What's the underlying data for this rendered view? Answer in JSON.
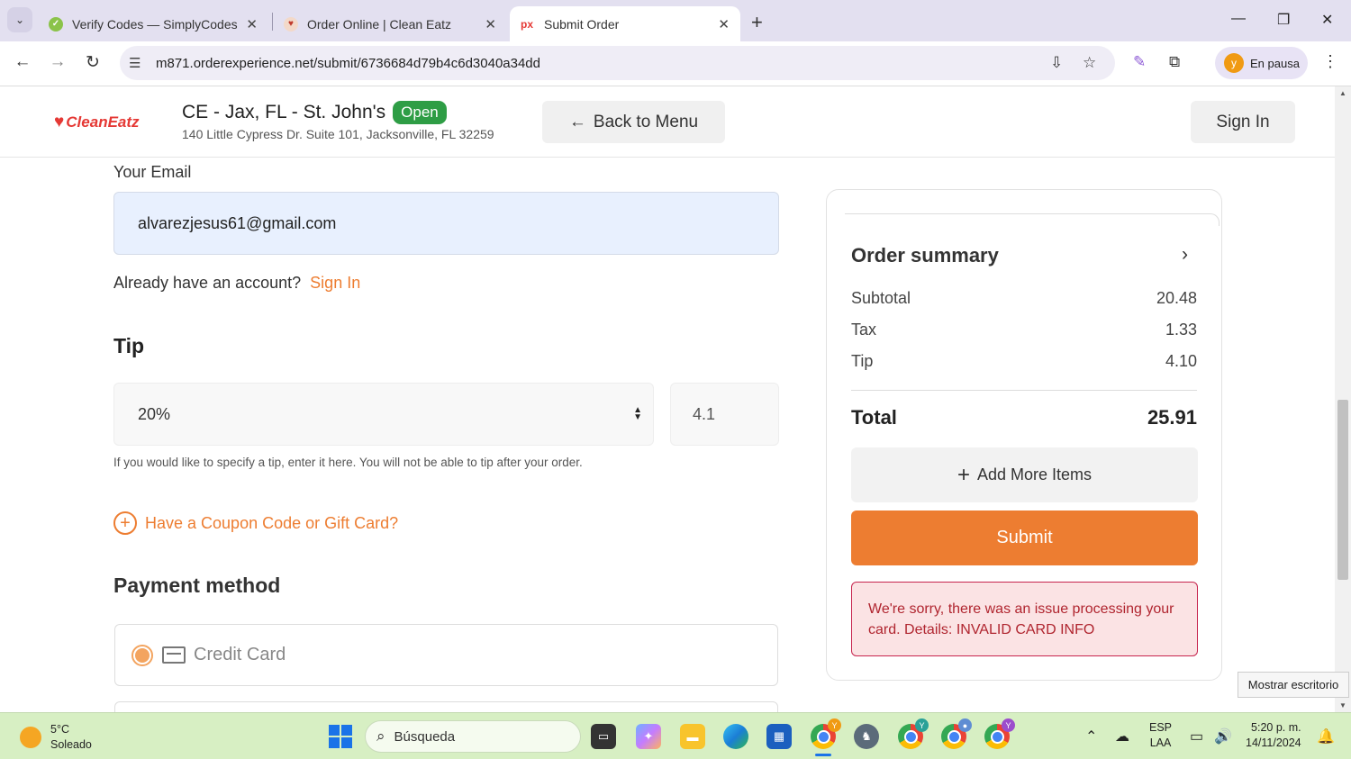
{
  "browser": {
    "tabs": [
      {
        "title": "Verify Codes — SimplyCodes",
        "favicon": "check-icon"
      },
      {
        "title": "Order Online | Clean Eatz",
        "favicon": "clean-eatz-icon"
      },
      {
        "title": "Submit Order",
        "favicon": "px-icon",
        "favicon_text": "px"
      }
    ],
    "url": "m871.orderexperience.net/submit/6736684d79b4c6d3040a34dd",
    "profile_label": "En pausa",
    "profile_initial": "y"
  },
  "header": {
    "logo_text": "CleanEatz",
    "store_name": "CE - Jax, FL - St. John's",
    "status_badge": "Open",
    "address": "140 Little Cypress Dr. Suite 101, Jacksonville, FL 32259",
    "back_label": "Back to Menu",
    "signin_label": "Sign In"
  },
  "form": {
    "email_label": "Your Email",
    "email_value": "alvarezjesus61@gmail.com",
    "account_prompt": "Already have an account?",
    "account_link": "Sign In",
    "tip_title": "Tip",
    "tip_select_value": "20%",
    "tip_amount_value": "4.1",
    "tip_help": "If you would like to specify a tip, enter it here. You will not be able to tip after your order.",
    "coupon_label": "Have a Coupon Code or Gift Card?",
    "payment_title": "Payment method",
    "payment_option": "Credit Card"
  },
  "summary": {
    "title": "Order summary",
    "rows": [
      {
        "label": "Subtotal",
        "value": "20.48"
      },
      {
        "label": "Tax",
        "value": "1.33"
      },
      {
        "label": "Tip",
        "value": "4.10"
      }
    ],
    "total_label": "Total",
    "total_value": "25.91",
    "add_items_label": "Add More Items",
    "submit_label": "Submit",
    "error_text": "We're sorry, there was an issue processing your card. Details: INVALID CARD INFO"
  },
  "tooltip": "Mostrar escritorio",
  "taskbar": {
    "weather_temp": "5°C",
    "weather_desc": "Soleado",
    "search_placeholder": "Búsqueda",
    "lang_top": "ESP",
    "lang_bottom": "LAA",
    "time": "5:20 p. m.",
    "date": "14/11/2024",
    "badge_letter": "Y"
  },
  "colors": {
    "accent": "#ed7d31",
    "open_badge": "#2e9d45",
    "error_text": "#b0252f",
    "error_bg": "#fbe3e4",
    "tab_strip": "#e3e0f0",
    "taskbar": "#d7efc3"
  }
}
